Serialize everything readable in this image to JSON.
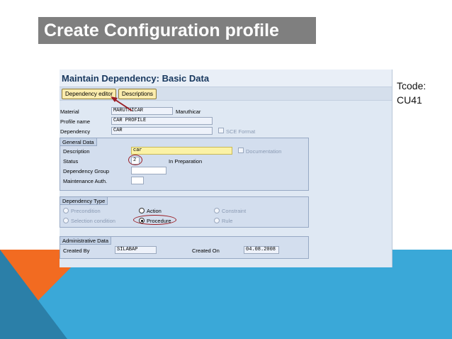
{
  "slide": {
    "title": "Create Configuration profile",
    "tcode_label": "Tcode:",
    "tcode_value": "CU41"
  },
  "sap": {
    "title": "Maintain Dependency: Basic Data",
    "toolbar": {
      "dependency_editor": "Dependency editor",
      "descriptions": "Descriptions"
    },
    "header": {
      "material_label": "Material",
      "material_value": "MARUTHICAR",
      "material_text": "Maruthicar",
      "profile_label": "Profile name",
      "profile_value": "CAR PROFILE",
      "dependency_label": "Dependency",
      "dependency_value": "CAR",
      "sce_format_label": "SCE Format"
    },
    "general": {
      "title": "General Data",
      "description_label": "Description",
      "description_value": "car",
      "documentation_label": "Documentation",
      "status_label": "Status",
      "status_value": "2",
      "status_text": "In Preparation",
      "group_label": "Dependency Group",
      "group_value": "",
      "auth_label": "Maintenance Auth.",
      "auth_value": ""
    },
    "dep_type": {
      "title": "Dependency Type",
      "precondition": "Precondition",
      "action": "Action",
      "constraint": "Constraint",
      "selection_condition": "Selection condition",
      "procedure": "Procedure",
      "rule": "Rule",
      "selected": "Procedure"
    },
    "admin": {
      "title": "Administrative Data",
      "created_by_label": "Created By",
      "created_by_value": "SILABAP",
      "created_on_label": "Created On",
      "created_on_value": "04.08.2008"
    }
  },
  "colors": {
    "title_bg": "#7f7f7f",
    "highlight": "#9b1d24",
    "band_blue": "#3aa8d8",
    "band_orange": "#f26b21"
  }
}
